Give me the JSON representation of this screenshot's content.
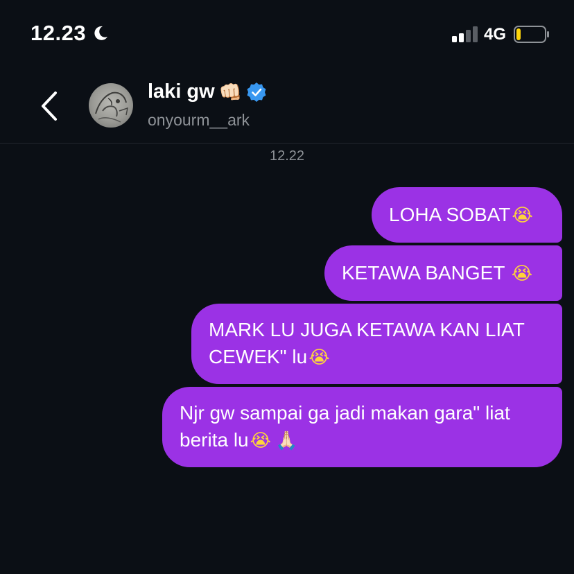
{
  "status_bar": {
    "time": "12.23",
    "network": "4G",
    "moon_icon": "moon-icon",
    "signal_icon": "signal-bars-icon",
    "battery_icon": "battery-low-icon",
    "battery_level": 0.15
  },
  "header": {
    "back_icon": "chevron-left-icon",
    "contact_name": "laki gw",
    "name_emoji": "👊🏻",
    "verified_icon": "verified-badge-icon",
    "handle": "onyourm__ark"
  },
  "conversation": {
    "timestamp": "12.22",
    "messages": [
      {
        "text": "LOHA SOBAT",
        "emoji": "😭"
      },
      {
        "text": "KETAWA BANGET ",
        "emoji": "😭"
      },
      {
        "text": "MARK LU JUGA KETAWA KAN LIAT CEWEK\" lu",
        "emoji": "😭"
      },
      {
        "text": "Njr gw sampai ga jadi makan gara\" liat berita lu",
        "emoji": "😭",
        "emoji2": "🙏🏻"
      }
    ]
  },
  "colors": {
    "background": "#0b0f15",
    "bubble": "#9b32e5",
    "verified": "#3897f0",
    "battery_fill": "#ffd60a",
    "secondary_text": "#8e9297"
  }
}
